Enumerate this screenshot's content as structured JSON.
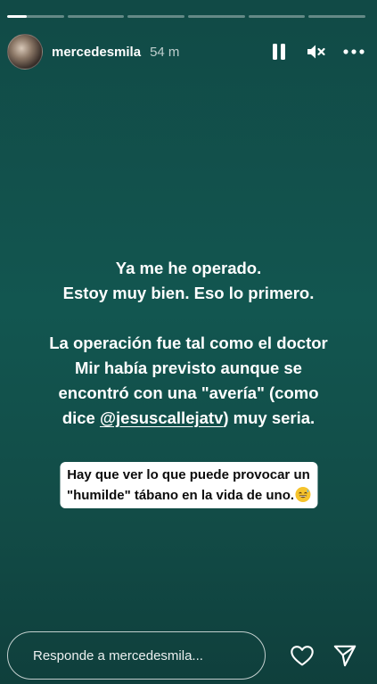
{
  "progress": {
    "segments": 6,
    "active_index": 0,
    "active_fraction": 0.35
  },
  "header": {
    "username": "mercedesmila",
    "time_ago": "54 m",
    "icons": [
      "pause-icon",
      "mute-icon",
      "more-icon"
    ]
  },
  "story": {
    "background_color": "#125650",
    "text_color": "#ffffff",
    "paragraph1": [
      "Ya me he operado.",
      "Estoy muy bien. Eso lo primero."
    ],
    "paragraph2": {
      "line1": "La operación fue tal como el doctor",
      "line2": "Mir había previsto aunque se",
      "line3": "encontró con una \"avería\" (como",
      "line4_before": "dice ",
      "mention": "@jesuscallejatv",
      "line4_after": ") muy seria."
    },
    "sticker": {
      "line1": "Hay que ver lo que puede provocar un",
      "line2": "\"humilde\" tábano en la vida de uno.",
      "emoji": "grinning-sweat-face"
    }
  },
  "footer": {
    "reply_placeholder": "Responde a mercedesmila...",
    "icons": [
      "heart-icon",
      "send-icon"
    ]
  }
}
